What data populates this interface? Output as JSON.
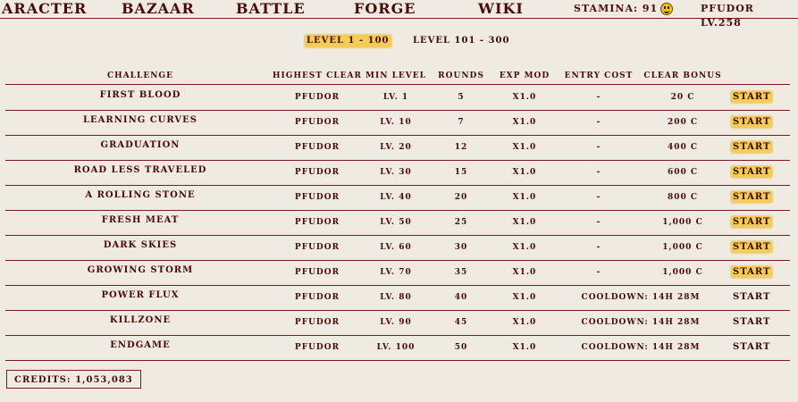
{
  "nav": {
    "items": [
      "ARACTER",
      "BAZAAR",
      "BATTLE",
      "FORGE",
      "WIKI"
    ],
    "stamina_label": "STAMINA: 91",
    "stamina_icon": "smiley-icon",
    "player": "PFUDOR LV.258"
  },
  "level_tabs": [
    "LEVEL 1 - 100",
    "LEVEL 101 - 300"
  ],
  "table": {
    "headers": [
      "CHALLENGE",
      "HIGHEST CLEAR",
      "MIN LEVEL",
      "ROUNDS",
      "EXP MOD",
      "ENTRY COST",
      "CLEAR BONUS"
    ],
    "rows": [
      {
        "challenge": "FIRST BLOOD",
        "highest": "PFUDOR",
        "min_level": "LV. 1",
        "rounds": "5",
        "exp": "X1.0",
        "entry": "-",
        "bonus": "20 C",
        "action": "START",
        "ready": true
      },
      {
        "challenge": "LEARNING CURVES",
        "highest": "PFUDOR",
        "min_level": "LV. 10",
        "rounds": "7",
        "exp": "X1.0",
        "entry": "-",
        "bonus": "200 C",
        "action": "START",
        "ready": true
      },
      {
        "challenge": "GRADUATION",
        "highest": "PFUDOR",
        "min_level": "LV. 20",
        "rounds": "12",
        "exp": "X1.0",
        "entry": "-",
        "bonus": "400 C",
        "action": "START",
        "ready": true
      },
      {
        "challenge": "ROAD LESS TRAVELED",
        "highest": "PFUDOR",
        "min_level": "LV. 30",
        "rounds": "15",
        "exp": "X1.0",
        "entry": "-",
        "bonus": "600 C",
        "action": "START",
        "ready": true
      },
      {
        "challenge": "A ROLLING STONE",
        "highest": "PFUDOR",
        "min_level": "LV. 40",
        "rounds": "20",
        "exp": "X1.0",
        "entry": "-",
        "bonus": "800 C",
        "action": "START",
        "ready": true
      },
      {
        "challenge": "FRESH MEAT",
        "highest": "PFUDOR",
        "min_level": "LV. 50",
        "rounds": "25",
        "exp": "X1.0",
        "entry": "-",
        "bonus": "1,000 C",
        "action": "START",
        "ready": true
      },
      {
        "challenge": "DARK SKIES",
        "highest": "PFUDOR",
        "min_level": "LV. 60",
        "rounds": "30",
        "exp": "X1.0",
        "entry": "-",
        "bonus": "1,000 C",
        "action": "START",
        "ready": true
      },
      {
        "challenge": "GROWING STORM",
        "highest": "PFUDOR",
        "min_level": "LV. 70",
        "rounds": "35",
        "exp": "X1.0",
        "entry": "-",
        "bonus": "1,000 C",
        "action": "START",
        "ready": true
      },
      {
        "challenge": "POWER FLUX",
        "highest": "PFUDOR",
        "min_level": "LV. 80",
        "rounds": "40",
        "exp": "X1.0",
        "entry": "COOLDOWN: 14H 28M",
        "bonus": "",
        "action": "START",
        "ready": false
      },
      {
        "challenge": "KILLZONE",
        "highest": "PFUDOR",
        "min_level": "LV. 90",
        "rounds": "45",
        "exp": "X1.0",
        "entry": "COOLDOWN: 14H 28M",
        "bonus": "",
        "action": "START",
        "ready": false
      },
      {
        "challenge": "ENDGAME",
        "highest": "PFUDOR",
        "min_level": "LV. 100",
        "rounds": "50",
        "exp": "X1.0",
        "entry": "COOLDOWN: 14H 28M",
        "bonus": "",
        "action": "START",
        "ready": false
      }
    ]
  },
  "credits": "CREDITS: 1,053,083",
  "colors": {
    "text": "#4a0a0a",
    "background": "#efebe3",
    "highlight": "#f3cd58",
    "rule": "#7a1a1a"
  }
}
